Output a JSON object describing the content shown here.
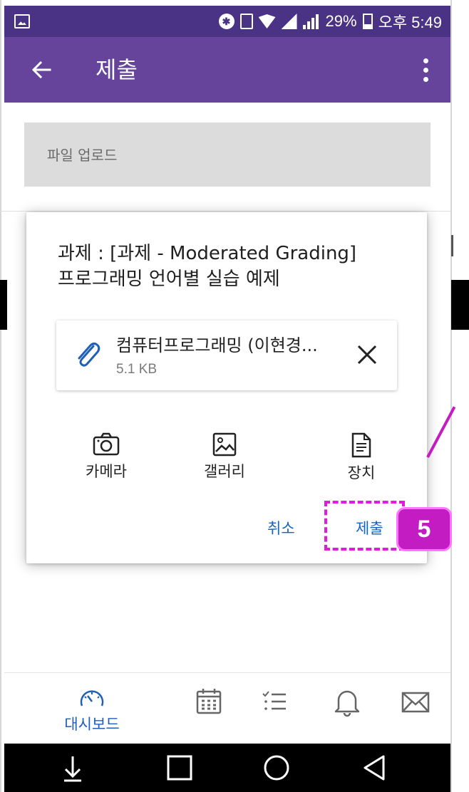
{
  "status_bar": {
    "battery": "29%",
    "time": "오후 5:49"
  },
  "app_bar": {
    "title": "제출"
  },
  "background": {
    "upload_label": "파일 업로드"
  },
  "dialog": {
    "title_line1": "과제 : [과제 - Moderated Grading]",
    "title_line2": "프로그래밍 언어별 실습 예제",
    "file": {
      "name": "컴퓨터프로그래밍 (이현경...",
      "size": "5.1 KB"
    },
    "sources": {
      "camera": "카메라",
      "gallery": "갤러리",
      "device": "장치"
    },
    "cancel_label": "취소",
    "submit_label": "제출"
  },
  "annotation": {
    "step": "5",
    "color": "#c21cc2"
  },
  "bottom_nav": {
    "dashboard_label": "대시보드",
    "active_color": "#1e5fb8"
  },
  "colors": {
    "status_bar": "#4a3285",
    "app_bar": "#66449c",
    "link": "#1565c0"
  }
}
